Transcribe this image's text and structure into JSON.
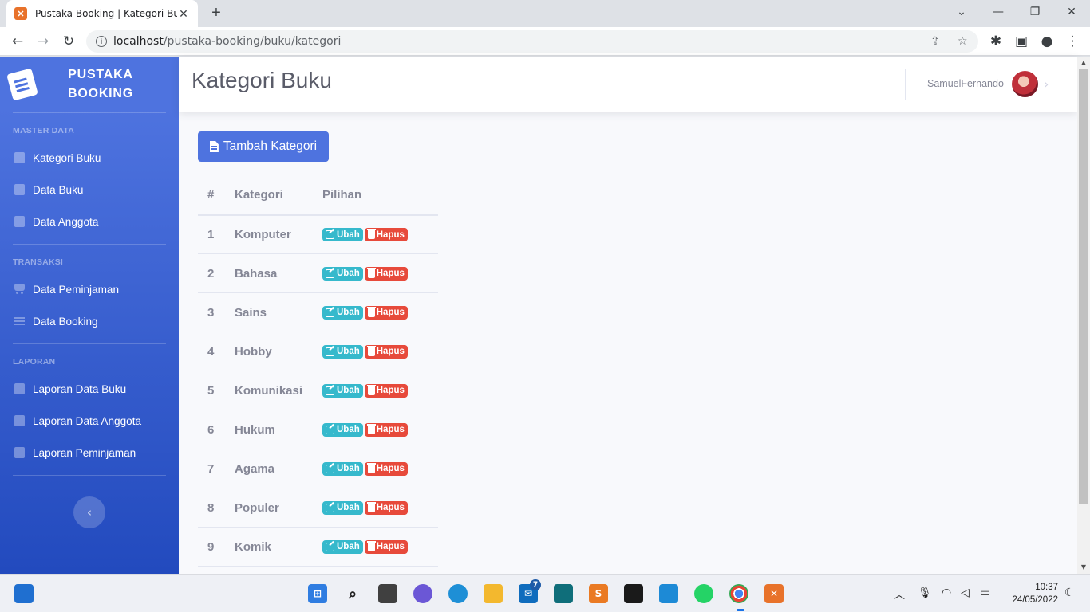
{
  "browser": {
    "tab_title": "Pustaka Booking | Kategori Buku",
    "url_host": "localhost",
    "url_path": "/pustaka-booking/buku/kategori"
  },
  "sidebar": {
    "brand": "PUSTAKA BOOKING",
    "sections": [
      {
        "heading": "MASTER DATA",
        "items": [
          "Kategori Buku",
          "Data Buku",
          "Data Anggota"
        ]
      },
      {
        "heading": "TRANSAKSI",
        "items": [
          "Data Peminjaman",
          "Data Booking"
        ]
      },
      {
        "heading": "LAPORAN",
        "items": [
          "Laporan Data Buku",
          "Laporan Data Anggota",
          "Laporan Peminjaman"
        ]
      }
    ]
  },
  "topbar": {
    "title": "Kategori Buku",
    "username": "SamuelFernando"
  },
  "main": {
    "add_button": "Tambah Kategori",
    "table": {
      "headers": [
        "#",
        "Kategori",
        "Pilihan"
      ],
      "edit_label": "Ubah",
      "delete_label": "Hapus",
      "rows": [
        {
          "no": "1",
          "kategori": "Komputer"
        },
        {
          "no": "2",
          "kategori": "Bahasa"
        },
        {
          "no": "3",
          "kategori": "Sains"
        },
        {
          "no": "4",
          "kategori": "Hobby"
        },
        {
          "no": "5",
          "kategori": "Komunikasi"
        },
        {
          "no": "6",
          "kategori": "Hukum"
        },
        {
          "no": "7",
          "kategori": "Agama"
        },
        {
          "no": "8",
          "kategori": "Populer"
        },
        {
          "no": "9",
          "kategori": "Komik"
        }
      ]
    }
  },
  "taskbar": {
    "mail_badge": "7",
    "time": "10:37",
    "date": "24/05/2022"
  },
  "colors": {
    "primary": "#4e73df",
    "info": "#36b9cc",
    "danger": "#e74a3b"
  }
}
